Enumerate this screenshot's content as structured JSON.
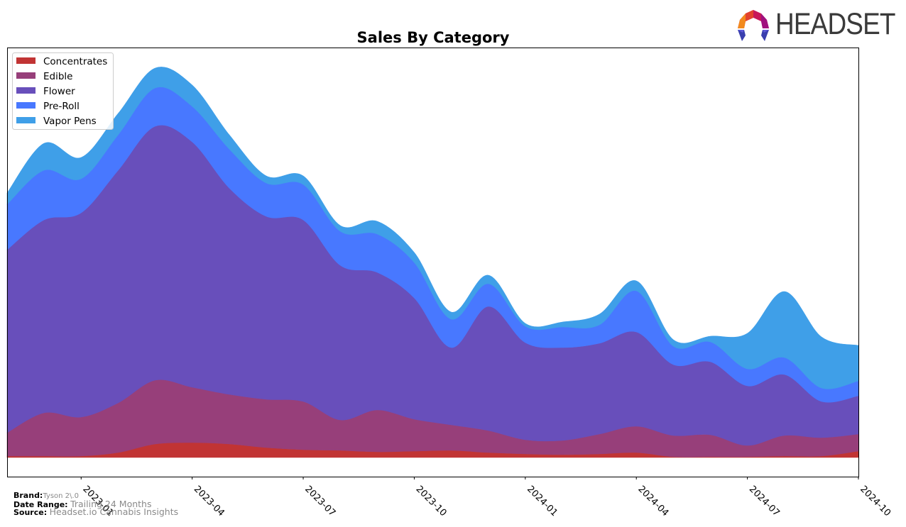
{
  "chart_data": {
    "type": "area",
    "stacked": true,
    "title": "Sales By Category",
    "xlabel": "",
    "ylabel": "",
    "y_ticks_visible": false,
    "grid": false,
    "legend_position": "top-left",
    "x": [
      "2022-11",
      "2022-12",
      "2023-01",
      "2023-02",
      "2023-03",
      "2023-04",
      "2023-05",
      "2023-06",
      "2023-07",
      "2023-08",
      "2023-09",
      "2023-10",
      "2023-11",
      "2023-12",
      "2024-01",
      "2024-02",
      "2024-03",
      "2024-04",
      "2024-05",
      "2024-06",
      "2024-07",
      "2024-08",
      "2024-09",
      "2024-10"
    ],
    "x_tick_labels": [
      "2023-01",
      "2023-04",
      "2023-07",
      "2023-10",
      "2024-01",
      "2024-04",
      "2024-07",
      "2024-10"
    ],
    "ylim": [
      -27,
      578
    ],
    "series": [
      {
        "name": "Concentrates",
        "color": "#c13434",
        "values": [
          2,
          2,
          2,
          7,
          19,
          21,
          19,
          14,
          11,
          10,
          8,
          9,
          10,
          7,
          5,
          4,
          5,
          7,
          1,
          1,
          1,
          2,
          2,
          9
        ]
      },
      {
        "name": "Edible",
        "color": "#973f7a",
        "values": [
          33,
          61,
          55,
          70,
          90,
          78,
          70,
          68,
          68,
          43,
          59,
          45,
          36,
          31,
          20,
          20,
          28,
          37,
          30,
          31,
          16,
          29,
          26,
          24
        ]
      },
      {
        "name": "Flower",
        "color": "#684fbb",
        "values": [
          258,
          272,
          288,
          328,
          358,
          346,
          291,
          258,
          256,
          218,
          194,
          171,
          109,
          175,
          137,
          131,
          128,
          133,
          100,
          103,
          84,
          86,
          51,
          54
        ]
      },
      {
        "name": "Pre-Roll",
        "color": "#4878ff",
        "values": [
          64,
          70,
          48,
          50,
          54,
          50,
          55,
          47,
          50,
          48,
          54,
          50,
          40,
          32,
          23,
          29,
          26,
          58,
          26,
          28,
          24,
          24,
          19,
          21
        ]
      },
      {
        "name": "Vapor Pens",
        "color": "#3f9fe8",
        "values": [
          16,
          38,
          30,
          30,
          28,
          30,
          20,
          10,
          12,
          8,
          18,
          14,
          10,
          12,
          4,
          7,
          15,
          14,
          9,
          8,
          50,
          93,
          72,
          50
        ]
      }
    ]
  },
  "footer": {
    "brand_label": "Brand:",
    "brand_value": "Tyson 2\\.0",
    "date_label": "Date Range:",
    "date_value": "Trailing 24 Months",
    "source_label": "Source:",
    "source_value": "Headset.io Cannabis Insights"
  },
  "logo": {
    "text": "HEADSET"
  }
}
